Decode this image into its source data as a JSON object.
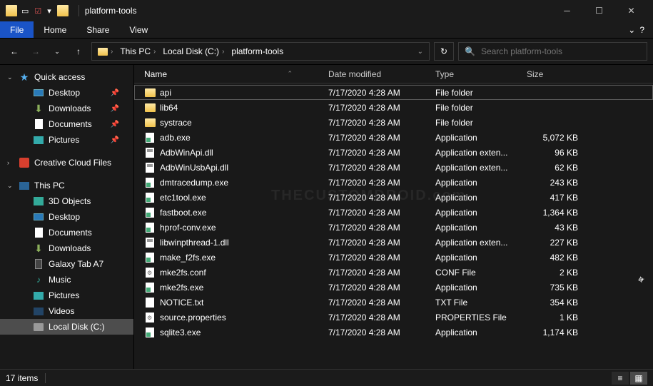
{
  "window": {
    "title": "platform-tools"
  },
  "tabs": {
    "file": "File",
    "home": "Home",
    "share": "Share",
    "view": "View"
  },
  "breadcrumb": {
    "root": "This PC",
    "drive": "Local Disk (C:)",
    "folder": "platform-tools"
  },
  "search": {
    "placeholder": "Search platform-tools"
  },
  "sidebar": {
    "quick_access": "Quick access",
    "qa_items": [
      {
        "label": "Desktop",
        "pinned": true,
        "icon": "desktop"
      },
      {
        "label": "Downloads",
        "pinned": true,
        "icon": "downloads"
      },
      {
        "label": "Documents",
        "pinned": true,
        "icon": "doc"
      },
      {
        "label": "Pictures",
        "pinned": true,
        "icon": "pic"
      }
    ],
    "cc": "Creative Cloud Files",
    "this_pc": "This PC",
    "pc_items": [
      {
        "label": "3D Objects",
        "icon": "3d"
      },
      {
        "label": "Desktop",
        "icon": "desktop"
      },
      {
        "label": "Documents",
        "icon": "doc"
      },
      {
        "label": "Downloads",
        "icon": "downloads"
      },
      {
        "label": "Galaxy Tab A7",
        "icon": "tablet"
      },
      {
        "label": "Music",
        "icon": "music"
      },
      {
        "label": "Pictures",
        "icon": "pic"
      },
      {
        "label": "Videos",
        "icon": "video"
      },
      {
        "label": "Local Disk (C:)",
        "icon": "disk",
        "selected": true
      }
    ]
  },
  "columns": {
    "name": "Name",
    "date": "Date modified",
    "type": "Type",
    "size": "Size"
  },
  "files": [
    {
      "name": "api",
      "date": "7/17/2020 4:28 AM",
      "type": "File folder",
      "size": "",
      "icon": "fold",
      "selected": true
    },
    {
      "name": "lib64",
      "date": "7/17/2020 4:28 AM",
      "type": "File folder",
      "size": "",
      "icon": "fold"
    },
    {
      "name": "systrace",
      "date": "7/17/2020 4:28 AM",
      "type": "File folder",
      "size": "",
      "icon": "fold"
    },
    {
      "name": "adb.exe",
      "date": "7/17/2020 4:28 AM",
      "type": "Application",
      "size": "5,072 KB",
      "icon": "exe"
    },
    {
      "name": "AdbWinApi.dll",
      "date": "7/17/2020 4:28 AM",
      "type": "Application exten...",
      "size": "96 KB",
      "icon": "dll"
    },
    {
      "name": "AdbWinUsbApi.dll",
      "date": "7/17/2020 4:28 AM",
      "type": "Application exten...",
      "size": "62 KB",
      "icon": "dll"
    },
    {
      "name": "dmtracedump.exe",
      "date": "7/17/2020 4:28 AM",
      "type": "Application",
      "size": "243 KB",
      "icon": "exe"
    },
    {
      "name": "etc1tool.exe",
      "date": "7/17/2020 4:28 AM",
      "type": "Application",
      "size": "417 KB",
      "icon": "exe"
    },
    {
      "name": "fastboot.exe",
      "date": "7/17/2020 4:28 AM",
      "type": "Application",
      "size": "1,364 KB",
      "icon": "exe"
    },
    {
      "name": "hprof-conv.exe",
      "date": "7/17/2020 4:28 AM",
      "type": "Application",
      "size": "43 KB",
      "icon": "exe"
    },
    {
      "name": "libwinpthread-1.dll",
      "date": "7/17/2020 4:28 AM",
      "type": "Application exten...",
      "size": "227 KB",
      "icon": "dll"
    },
    {
      "name": "make_f2fs.exe",
      "date": "7/17/2020 4:28 AM",
      "type": "Application",
      "size": "482 KB",
      "icon": "exe"
    },
    {
      "name": "mke2fs.conf",
      "date": "7/17/2020 4:28 AM",
      "type": "CONF File",
      "size": "2 KB",
      "icon": "conf"
    },
    {
      "name": "mke2fs.exe",
      "date": "7/17/2020 4:28 AM",
      "type": "Application",
      "size": "735 KB",
      "icon": "exe"
    },
    {
      "name": "NOTICE.txt",
      "date": "7/17/2020 4:28 AM",
      "type": "TXT File",
      "size": "354 KB",
      "icon": "txt"
    },
    {
      "name": "source.properties",
      "date": "7/17/2020 4:28 AM",
      "type": "PROPERTIES File",
      "size": "1 KB",
      "icon": "conf"
    },
    {
      "name": "sqlite3.exe",
      "date": "7/17/2020 4:28 AM",
      "type": "Application",
      "size": "1,174 KB",
      "icon": "exe"
    }
  ],
  "status": {
    "items": "17 items"
  },
  "watermark": "THECUSTOMDROID.com"
}
